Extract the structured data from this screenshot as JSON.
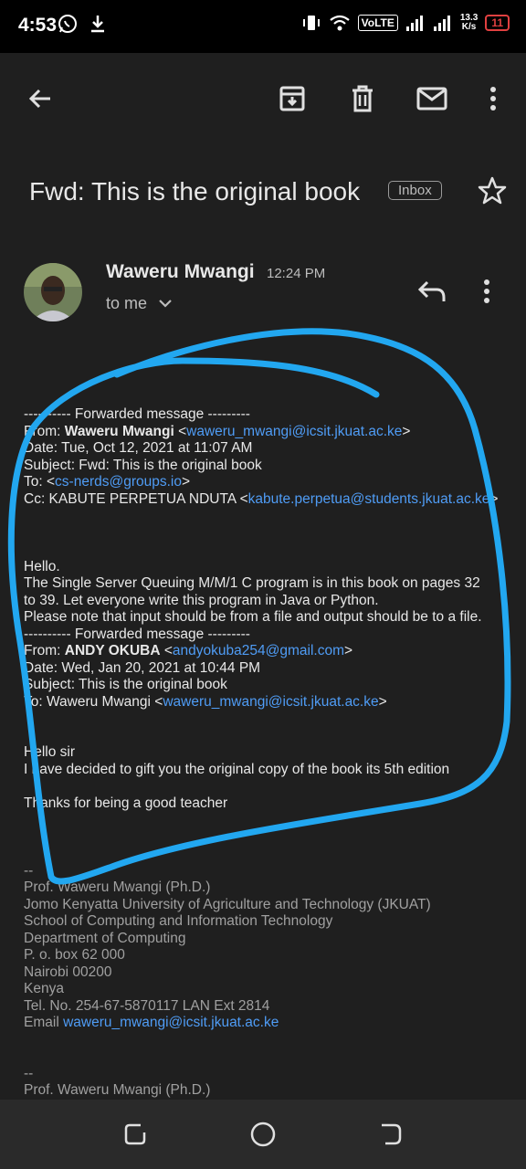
{
  "status": {
    "time": "4:53",
    "network": "VoLTE",
    "speed_top": "13.3",
    "speed_bottom": "K/s",
    "battery": "11"
  },
  "email": {
    "subject": "Fwd: This is the original book",
    "label": "Inbox",
    "sender": "Waweru Mwangi",
    "time": "12:24 PM",
    "to": "to me"
  },
  "body": {
    "fwd1_header": "---------- Forwarded message ---------",
    "from_label": "From: ",
    "from1_name": "Waweru Mwangi",
    "from1_open": " <",
    "from1_email": "waweru_mwangi@icsit.jkuat.ac.ke",
    "close": ">",
    "date1": "Date: Tue, Oct 12, 2021 at 11:07 AM",
    "subject1": "Subject: Fwd: This is the original book",
    "to1_label": "To: <",
    "to1_email": "cs-nerds@groups.io",
    "cc1_label": "Cc: KABUTE PERPETUA NDUTA <",
    "cc1_email": "kabute.perpetua@students.jkuat.ac.ke",
    "hello": "Hello.",
    "p1": "The Single Server Queuing M/M/1 C program is in this book on pages  32",
    "p2": "to 39. Let everyone write this program in Java or Python.",
    "p3": "Please note that input should be from a file and output should be to a file.",
    "fwd2_header": "---------- Forwarded message ---------",
    "from2_name": "ANDY OKUBA",
    "from2_open": " <",
    "from2_email": "andyokuba254@gmail.com",
    "date2": "Date: Wed, Jan 20, 2021 at 10:44 PM",
    "subject2": "Subject: This is the original book",
    "to2_label": "To: Waweru Mwangi <",
    "to2_email": "waweru_mwangi@icsit.jkuat.ac.ke",
    "m1": "Hello sir",
    "m2": "I have decided to gift you the original copy of the book its 5th edition",
    "m3": "Thanks for being a good teacher",
    "sig_dash": "--",
    "sig1": "Prof. Waweru Mwangi (Ph.D.)",
    "sig2": "Jomo Kenyatta University of Agriculture and Technology (JKUAT)",
    "sig3": "School of Computing and Information Technology",
    "sig4": "Department of Computing",
    "sig5": "P. o. box 62 000",
    "sig6": "Nairobi 00200",
    "sig7": "Kenya",
    "sig8": "Tel. No. 254-67-5870117   LAN Ext 2814",
    "sig9_label": "Email ",
    "sig9_email": "waweru_mwangi@icsit.jkuat.ac.ke",
    "sig_dash2": "--",
    "sig10": "Prof. Waweru Mwangi (Ph.D.)"
  },
  "colors": {
    "link": "#4f9cf5",
    "scribble": "#22a7f0",
    "background": "#1f1f1f"
  },
  "icons": [
    "back-arrow-icon",
    "archive-icon",
    "delete-icon",
    "mail-icon",
    "more-vert-icon",
    "star-icon",
    "reply-icon",
    "chevron-down-icon",
    "recents-icon",
    "home-icon",
    "back-nav-icon"
  ]
}
